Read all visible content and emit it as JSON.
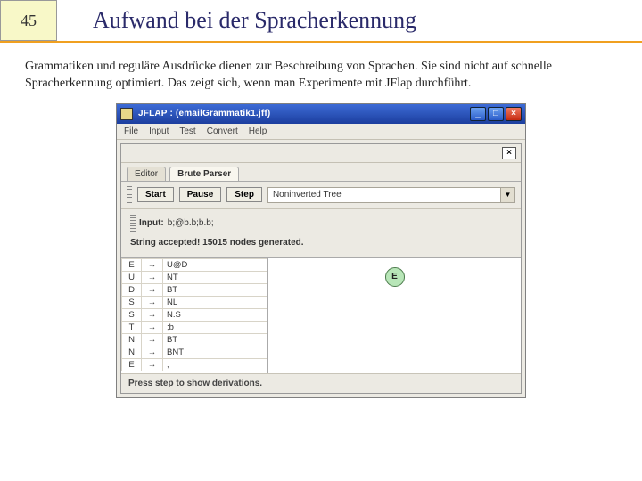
{
  "slide": {
    "number": "45",
    "title": "Aufwand bei der Spracherkennung",
    "body": "Grammatiken und reguläre Ausdrücke dienen zur Beschreibung von Sprachen. Sie sind nicht auf schnelle Spracherkennung optimiert. Das zeigt sich, wenn man Experimente mit JFlap durchführt."
  },
  "app": {
    "title": "JFLAP : (emailGrammatik1.jff)",
    "menubar": [
      "File",
      "Input",
      "Test",
      "Convert",
      "Help"
    ],
    "tabs": {
      "items": [
        "Editor",
        "Brute Parser"
      ],
      "activeIndex": 1
    },
    "toolbar": {
      "buttons": [
        "Start",
        "Pause",
        "Step"
      ],
      "combo": "Noninverted Tree"
    },
    "info": {
      "input_label": "Input:",
      "input_value": "b;@b.b;b.b;",
      "result": "String accepted! 15015 nodes generated."
    },
    "grammar": [
      {
        "lhs": "E",
        "rhs": "U@D"
      },
      {
        "lhs": "U",
        "rhs": "NT"
      },
      {
        "lhs": "D",
        "rhs": "BT"
      },
      {
        "lhs": "S",
        "rhs": "NL"
      },
      {
        "lhs": "S",
        "rhs": "N.S"
      },
      {
        "lhs": "T",
        "rhs": ";b"
      },
      {
        "lhs": "N",
        "rhs": "BT"
      },
      {
        "lhs": "N",
        "rhs": "BNT"
      },
      {
        "lhs": "E",
        "rhs": ";"
      }
    ],
    "tree_root": "E",
    "status": "Press step to show derivations."
  }
}
